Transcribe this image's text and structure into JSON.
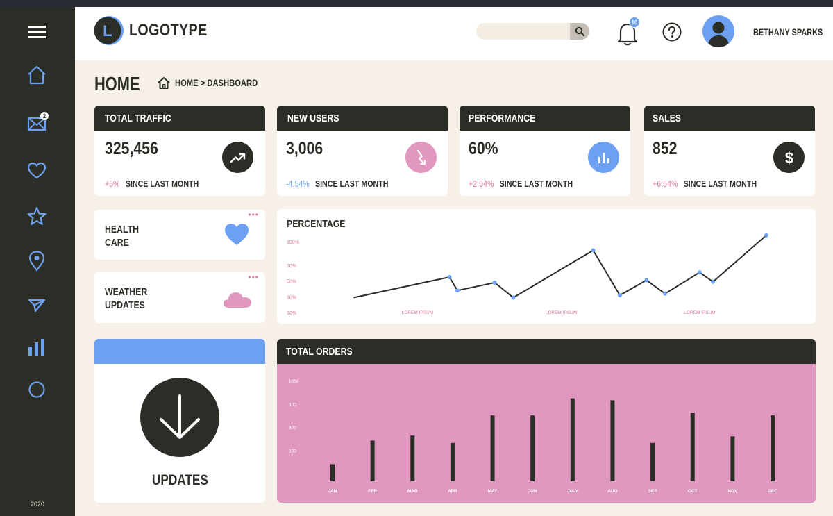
{
  "brand": {
    "logo_letter": "L",
    "logo_text": "LOGOTYPE"
  },
  "header": {
    "search_placeholder": "",
    "notification_count": "10",
    "user_name": "BETHANY SPARKS"
  },
  "sidebar": {
    "items": [
      {
        "icon": "menu-icon"
      },
      {
        "icon": "home-icon"
      },
      {
        "icon": "mail-icon",
        "badge": "2"
      },
      {
        "icon": "heart-icon"
      },
      {
        "icon": "star-icon"
      },
      {
        "icon": "location-pin-icon"
      },
      {
        "icon": "send-icon"
      },
      {
        "icon": "bar-chart-icon"
      },
      {
        "icon": "circle-icon"
      }
    ],
    "year": "2020"
  },
  "page": {
    "title": "HOME",
    "breadcrumb": "HOME > DASHBOARD"
  },
  "stats": [
    {
      "title": "TOTAL TRAFFIC",
      "value": "325,456",
      "change": "+5%",
      "since": "SINCE LAST MONTH",
      "icon": "trend-up-icon",
      "change_color": "#e07aa0",
      "icon_bg": "#2b2e26"
    },
    {
      "title": "NEW USERS",
      "value": "3,006",
      "change": "-4.54%",
      "since": "SINCE LAST MONTH",
      "icon": "trend-down-icon",
      "change_color": "#6ea0f2",
      "icon_bg": "#e097c0"
    },
    {
      "title": "PERFORMANCE",
      "value": "60%",
      "change": "+2.54%",
      "since": "SINCE LAST MONTH",
      "icon": "bar-chart-icon",
      "change_color": "#e07aa0",
      "icon_bg": "#6ea0f2"
    },
    {
      "title": "SALES",
      "value": "852",
      "change": "+6.54%",
      "since": "SINCE LAST MONTH",
      "icon": "dollar-icon",
      "change_color": "#e07aa0",
      "icon_bg": "#2b2e26"
    }
  ],
  "widgets": {
    "health": {
      "label_line1": "HEALTH",
      "label_line2": "CARE",
      "icon": "heart-icon"
    },
    "weather": {
      "label_line1": "WEATHER",
      "label_line2": "UPDATES",
      "icon": "cloud-icon"
    },
    "updates": {
      "label": "UPDATES",
      "icon": "arrow-down-icon"
    }
  },
  "colors": {
    "dark": "#2b2e26",
    "blue": "#6ea0f2",
    "pink": "#e097c0",
    "cream": "#f6f0e9"
  },
  "chart_data": [
    {
      "type": "line",
      "title": "PERCENTAGE",
      "y_ticks": [
        "100%",
        "70%",
        "50%",
        "30%",
        "10%"
      ],
      "y_tick_values": [
        100,
        70,
        50,
        30,
        10
      ],
      "x_labels": [
        "LOREM IPSUM",
        "LOREM IPSUM",
        "LOREM IPSUM"
      ],
      "x_label_positions": [
        2.4,
        7.8,
        13
      ],
      "x": [
        0,
        3.6,
        3.9,
        5.3,
        6,
        9,
        10,
        11,
        11.7,
        13,
        13.5,
        15.5
      ],
      "y": [
        29,
        55,
        38,
        48,
        29,
        89,
        32,
        51,
        34,
        61,
        49,
        108
      ],
      "xlim": [
        -1,
        16
      ],
      "ylim": [
        10,
        115
      ]
    },
    {
      "type": "bar",
      "title": "TOTAL ORDERS",
      "y_ticks": [
        "1000",
        "500",
        "300",
        "100"
      ],
      "y_tick_values": [
        1000,
        700,
        400,
        100
      ],
      "categories": [
        "JAN",
        "FEB",
        "MAR",
        "APR",
        "MAY",
        "JUN",
        "JULY",
        "AUG",
        "SEP",
        "OCT",
        "NOV",
        "DEC"
      ],
      "values": [
        -80,
        225,
        290,
        195,
        550,
        550,
        770,
        745,
        195,
        585,
        280,
        550
      ],
      "ylim": [
        -300,
        1000
      ]
    }
  ]
}
